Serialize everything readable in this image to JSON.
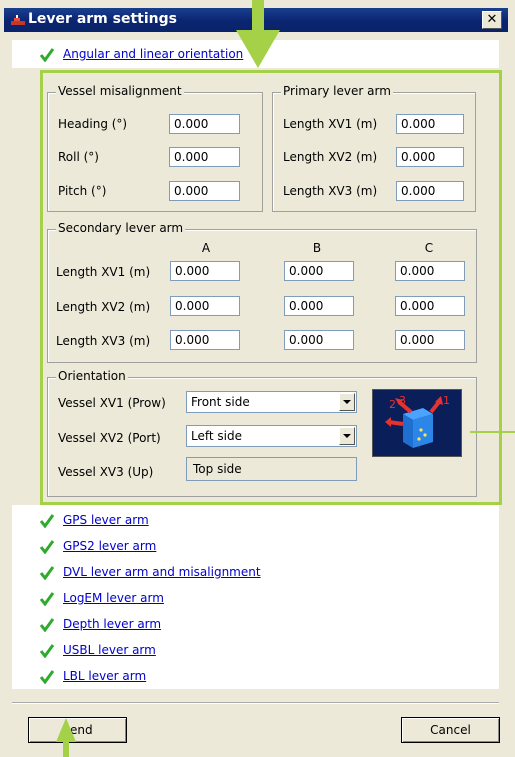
{
  "window": {
    "title": "Lever arm settings"
  },
  "top_link": {
    "label": "Angular and linear orientation"
  },
  "vessel_misalignment": {
    "title": "Vessel misalignment",
    "rows": [
      {
        "label": "Heading (°)",
        "value": "0.000"
      },
      {
        "label": "Roll (°)",
        "value": "0.000"
      },
      {
        "label": "Pitch (°)",
        "value": "0.000"
      }
    ]
  },
  "primary_lever_arm": {
    "title": "Primary lever arm",
    "rows": [
      {
        "label": "Length XV1 (m)",
        "value": "0.000"
      },
      {
        "label": "Length XV2 (m)",
        "value": "0.000"
      },
      {
        "label": "Length XV3 (m)",
        "value": "0.000"
      }
    ]
  },
  "secondary_lever_arm": {
    "title": "Secondary lever arm",
    "columns": [
      "A",
      "B",
      "C"
    ],
    "rows": [
      {
        "label": "Length XV1 (m)",
        "values": [
          "0.000",
          "0.000",
          "0.000"
        ]
      },
      {
        "label": "Length XV2 (m)",
        "values": [
          "0.000",
          "0.000",
          "0.000"
        ]
      },
      {
        "label": "Length XV3 (m)",
        "values": [
          "0.000",
          "0.000",
          "0.000"
        ]
      }
    ]
  },
  "orientation": {
    "title": "Orientation",
    "rows": [
      {
        "label": "Vessel XV1 (Prow)",
        "value": "Front side"
      },
      {
        "label": "Vessel XV2 (Port)",
        "value": "Left side"
      },
      {
        "label": "Vessel XV3 (Up)",
        "value": "Top side"
      }
    ],
    "axis_numbers": [
      "2",
      "3",
      "1"
    ]
  },
  "links": [
    {
      "label": "GPS lever arm"
    },
    {
      "label": "GPS2 lever arm"
    },
    {
      "label": "DVL lever arm and misalignment"
    },
    {
      "label": "LogEM lever arm"
    },
    {
      "label": "Depth lever arm"
    },
    {
      "label": "USBL lever arm"
    },
    {
      "label": "LBL lever arm"
    }
  ],
  "buttons": {
    "send": "Send",
    "cancel": "Cancel"
  },
  "colors": {
    "highlight": "#a4d147",
    "title_bar": "#0a246a",
    "check": "#2eaa2e",
    "link": "#0000cc"
  }
}
